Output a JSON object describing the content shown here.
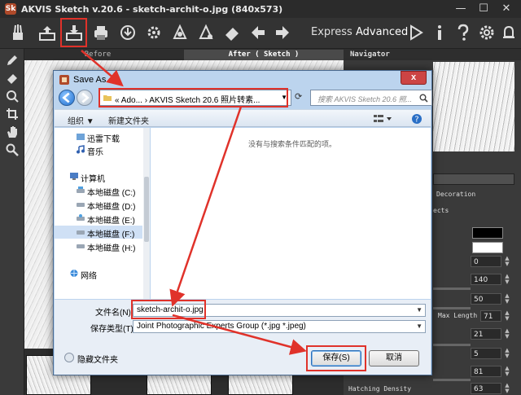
{
  "app": {
    "title": "AKVIS Sketch v.20.6 - sketch-archit-o.jpg (840x573)",
    "logo_text": "Sk",
    "minimize": "—",
    "maximize": "☐",
    "close": "✕"
  },
  "toolbar": {
    "express_label": "Express",
    "advanced_label": "Advanced"
  },
  "tabs": {
    "before": "Before",
    "after": "After ( Sketch )"
  },
  "right_panel": {
    "navigator_title": "Navigator",
    "decoration_tab": "Decoration",
    "effects_tab": "ects",
    "values": [
      "0",
      "140",
      "50",
      "71",
      "21",
      "5",
      "81",
      "63"
    ],
    "max_length_label": "Max Length",
    "hatching_density_label": "Hatching Density"
  },
  "dialog": {
    "title": "Save As",
    "close": "x",
    "address_path": "« Ado... › AKVIS Sketch 20.6 照片转素...",
    "search_placeholder": "搜索 AKVIS Sketch 20.6 照...",
    "organize": "组织 ▼",
    "new_folder": "新建文件夹",
    "empty_message": "没有与搜索条件匹配的项。",
    "nav_items": [
      {
        "label": "迅雷下载"
      },
      {
        "label": "音乐"
      },
      {
        "label": "计算机"
      },
      {
        "label": "本地磁盘 (C:)"
      },
      {
        "label": "本地磁盘 (D:)"
      },
      {
        "label": "本地磁盘 (E:)"
      },
      {
        "label": "本地磁盘 (F:)"
      },
      {
        "label": "本地磁盘 (H:)"
      },
      {
        "label": "网络"
      }
    ],
    "filename_label": "文件名(N):",
    "filename_value": "sketch-archit-o.jpg",
    "filetype_label": "保存类型(T):",
    "filetype_value": "Joint Photographic Experts Group (*.jpg *.jpeg)",
    "hide_folders": "隐藏文件夹",
    "save_button": "保存(S)",
    "cancel_button": "取消"
  },
  "colors": {
    "highlight": "#e0322a",
    "app_bg": "#3c3c3c",
    "dialog_frame": "#bcd4ee"
  }
}
